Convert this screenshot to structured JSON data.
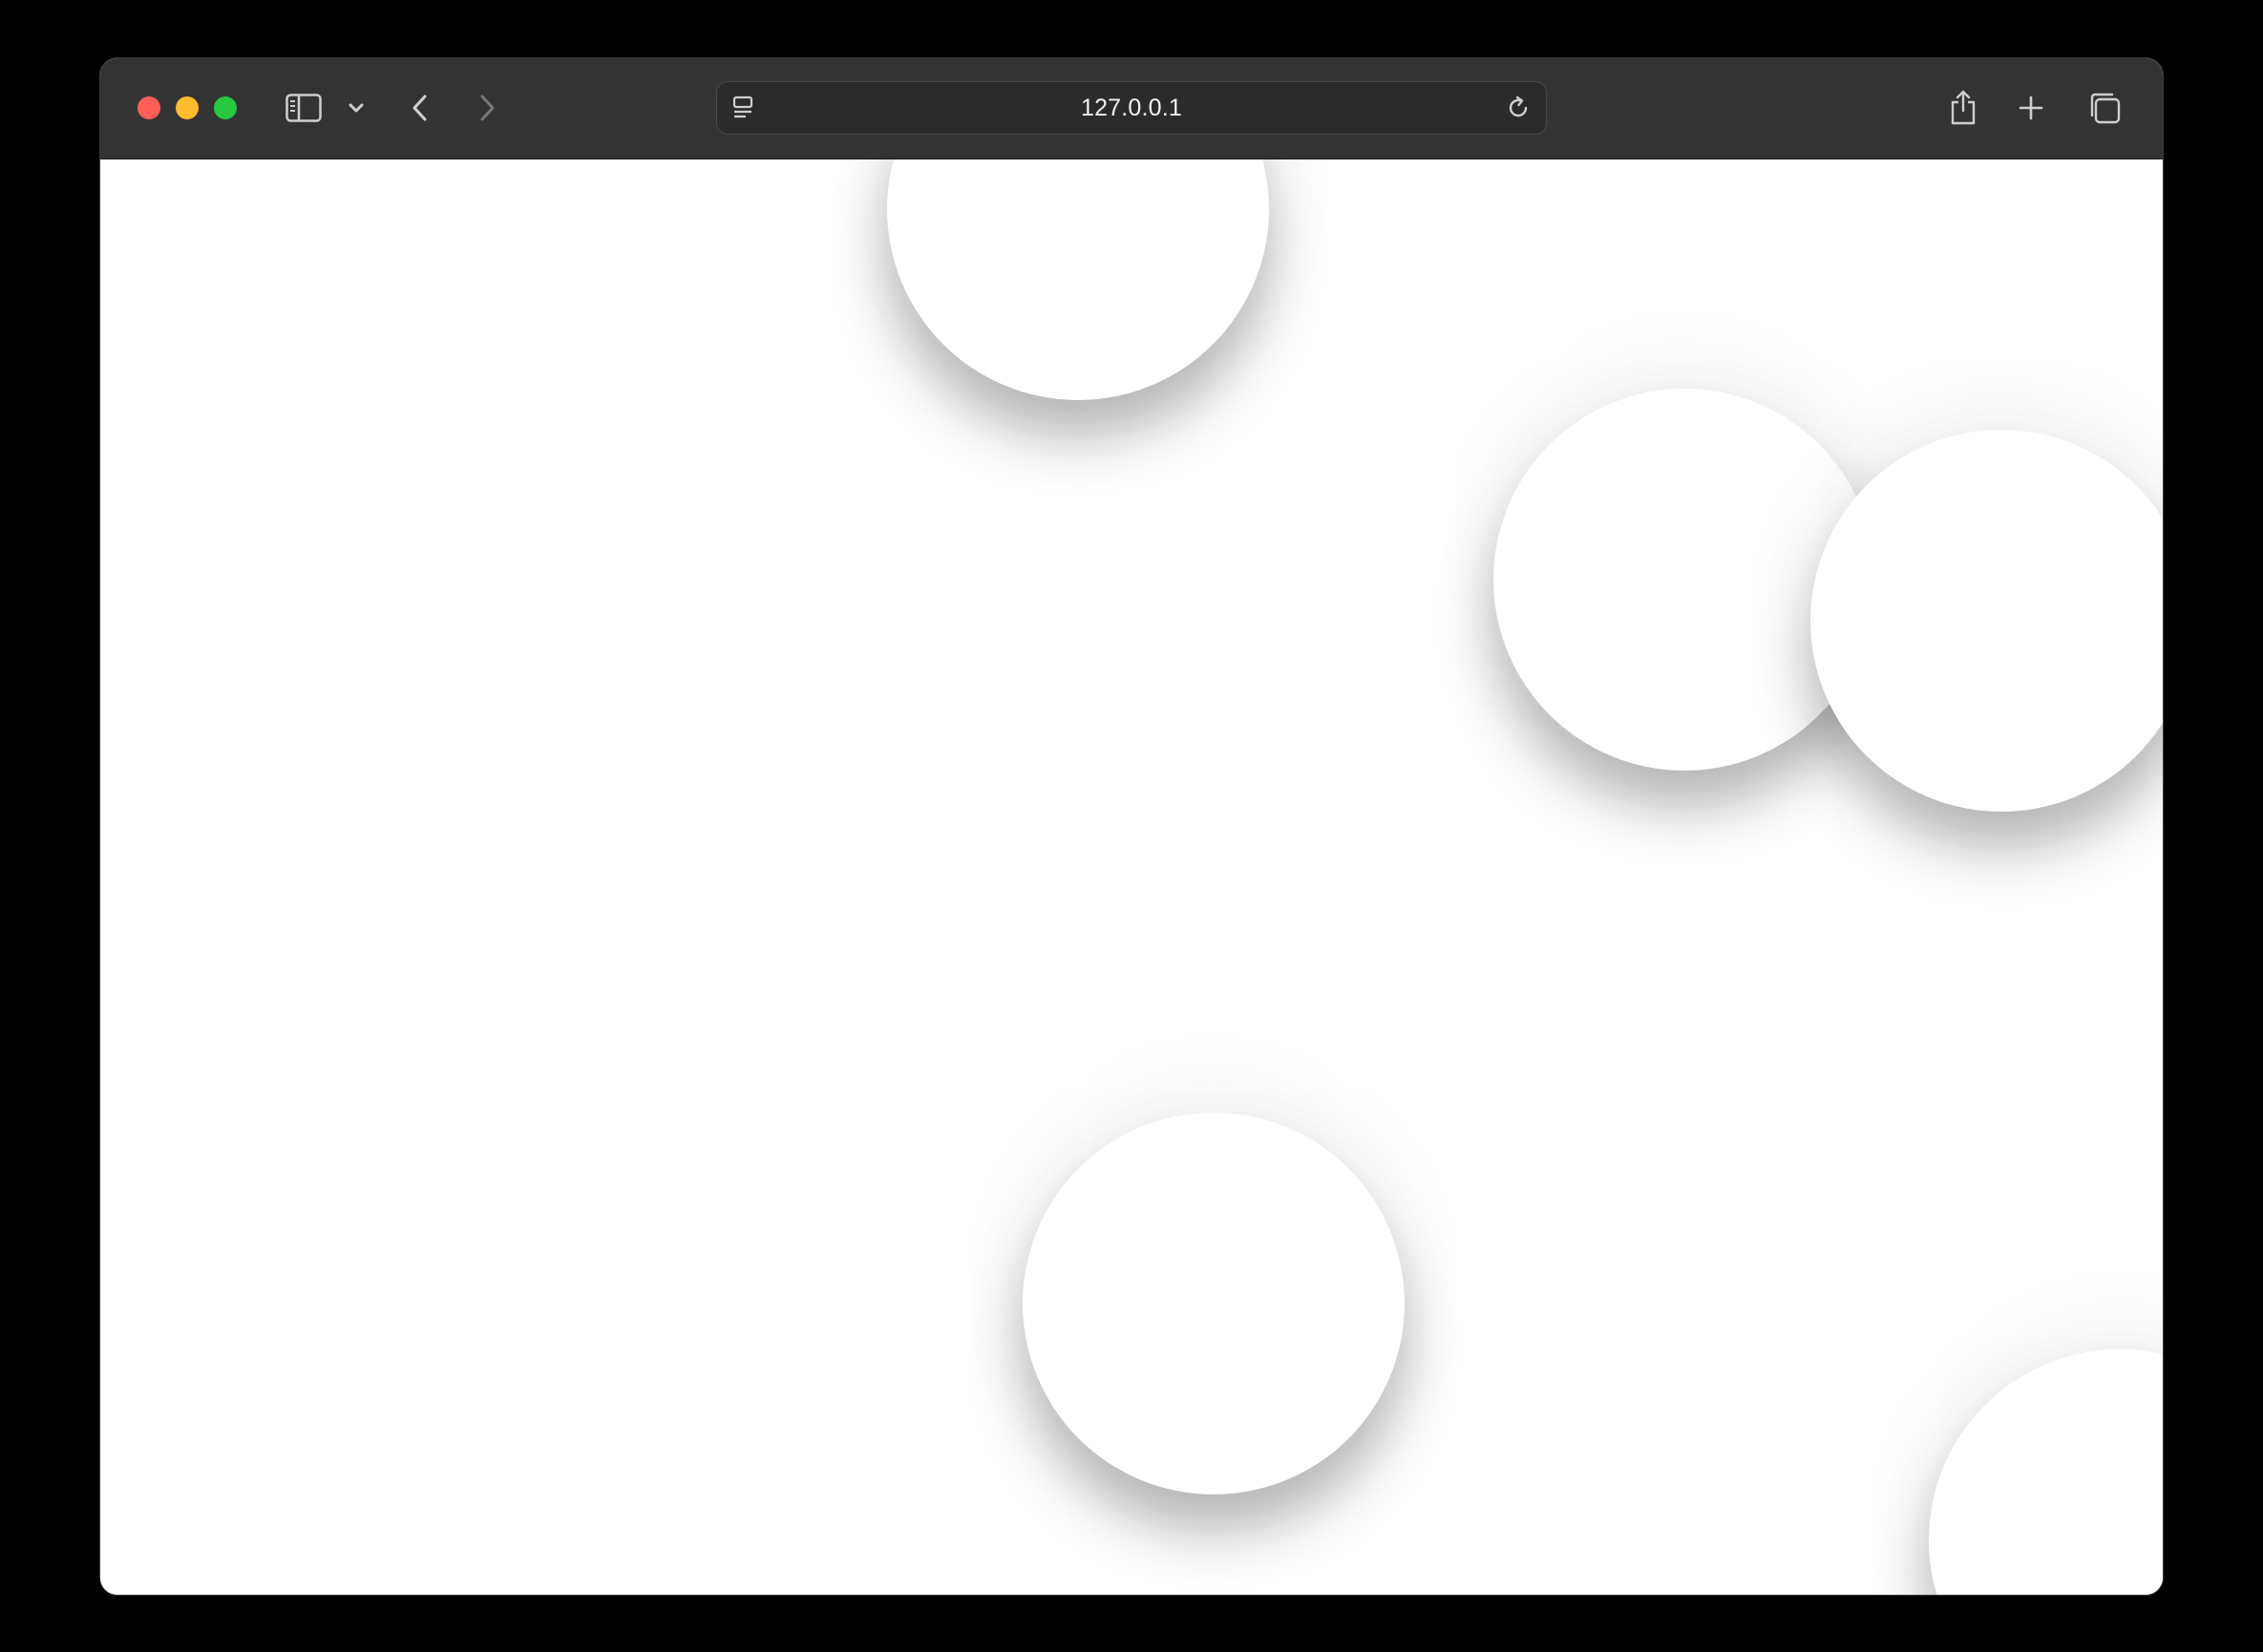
{
  "browser": {
    "address": "127.0.0.1",
    "icons": {
      "sidebar": "sidebar-toggle-icon",
      "sidebar_menu": "chevron-down-icon",
      "back": "back-arrow-icon",
      "forward": "forward-arrow-icon",
      "page_menu": "page-menu-icon",
      "reload": "reload-icon",
      "share": "share-icon",
      "new_tab": "plus-icon",
      "tabs": "tab-overview-icon"
    },
    "colors": {
      "toolbar": "#333333",
      "close": "#ff5f57",
      "minimize": "#febc2e",
      "zoom": "#28c840"
    }
  },
  "page": {
    "background": "#ffffff",
    "ball_count": 5
  }
}
